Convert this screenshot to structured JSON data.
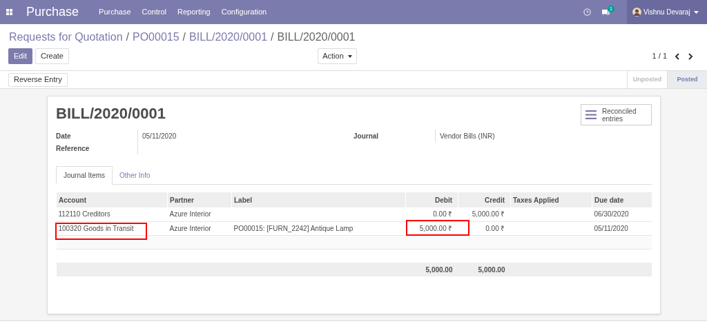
{
  "navbar": {
    "app": "Purchase",
    "menu": [
      "Purchase",
      "Control",
      "Reporting",
      "Configuration"
    ],
    "chat_count": "1",
    "user": "Vishnu Devaraj"
  },
  "breadcrumb": {
    "separator": "/",
    "items": [
      "Requests for Quotation",
      "PO00015",
      "BILL/2020/0001",
      "BILL/2020/0001"
    ]
  },
  "buttons": {
    "edit": "Edit",
    "create": "Create",
    "action": "Action",
    "pager": "1 / 1"
  },
  "status_bar": {
    "button": "Reverse Entry",
    "stages": [
      {
        "label": "Unposted",
        "selected": false
      },
      {
        "label": "Posted",
        "selected": true
      }
    ]
  },
  "form": {
    "title": "BILL/2020/0001",
    "smart_button": "Reconciled entries",
    "fields_left": [
      {
        "label": "Date",
        "value": "05/11/2020"
      },
      {
        "label": "Reference"
      }
    ],
    "fields_right": [
      {
        "label": "Journal",
        "value": "Vendor Bills (INR)"
      }
    ],
    "tabs": [
      {
        "label": "Journal Items",
        "selected": true
      },
      {
        "label": "Other Info",
        "selected": false
      }
    ],
    "table": {
      "columns": [
        "Account",
        "Partner",
        "Label",
        "Debit",
        "Credit",
        "Taxes Applied",
        "Due date"
      ],
      "rows": [
        {
          "cells": [
            "112110 Creditors",
            "Azure Interior",
            "",
            "0.00 ₹",
            "5,000.00 ₹",
            "",
            "06/30/2020"
          ],
          "highlighted": [
            false,
            false,
            false,
            false,
            false,
            false,
            false
          ]
        },
        {
          "cells": [
            "100320 Goods in Transit",
            "Azure Interior",
            "PO00015: [FURN_2242] Antique Lamp",
            "5,000.00 ₹",
            "0.00 ₹",
            "",
            "05/11/2020"
          ],
          "highlighted": [
            true,
            false,
            false,
            true,
            false,
            false,
            false
          ]
        }
      ],
      "totals": {
        "debit": "5,000.00",
        "credit": "5,000.00"
      }
    }
  }
}
